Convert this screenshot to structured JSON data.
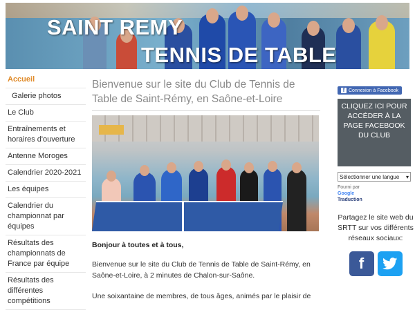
{
  "banner": {
    "line1": "SAINT REMY",
    "line2": "TENNIS DE TABLE"
  },
  "sidebar": {
    "items": [
      {
        "label": "Accueil",
        "active": true
      },
      {
        "label": "Galerie photos",
        "sub": true
      },
      {
        "label": "Le Club"
      },
      {
        "label": "Entraînements et horaires d'ouverture"
      },
      {
        "label": "Antenne Moroges"
      },
      {
        "label": "Calendrier 2020-2021"
      },
      {
        "label": "Les équipes"
      },
      {
        "label": "Calendrier du championnat par équipes"
      },
      {
        "label": "Résultats des championnats de France par équipe"
      },
      {
        "label": "Résultats des différentes compétitions"
      }
    ]
  },
  "main": {
    "title": "Bienvenue sur le site du Club de Tennis de Table de Saint-Rémy, en Saône-et-Loire",
    "greeting": "Bonjour à toutes et à tous,",
    "para1": "Bienvenue sur le site du Club de Tennis de Table de Saint-Rémy, en Saône-et-Loire, à 2 minutes de Chalon-sur-Saône.",
    "para2": "Une soixantaine de membres, de tous âges, animés par le plaisir de"
  },
  "right": {
    "fb_connect": "Connexion à Facebook",
    "fb_box": "CLIQUEZ ICI POUR ACCÉDER À LA PAGE FACEBOOK DU CLUB",
    "lang_select": "Sélectionner une langue",
    "powered": "Fourni par",
    "google": "Google",
    "translate": "Traduction",
    "share": "Partagez le site web du SRTT sur vos différents réseaux sociaux:"
  },
  "colors": {
    "accent": "#e08b2a",
    "facebook": "#3b5998",
    "twitter": "#1da1f2",
    "fb_box": "#555d63"
  },
  "icons": {
    "facebook": "facebook-icon",
    "twitter": "twitter-icon"
  }
}
